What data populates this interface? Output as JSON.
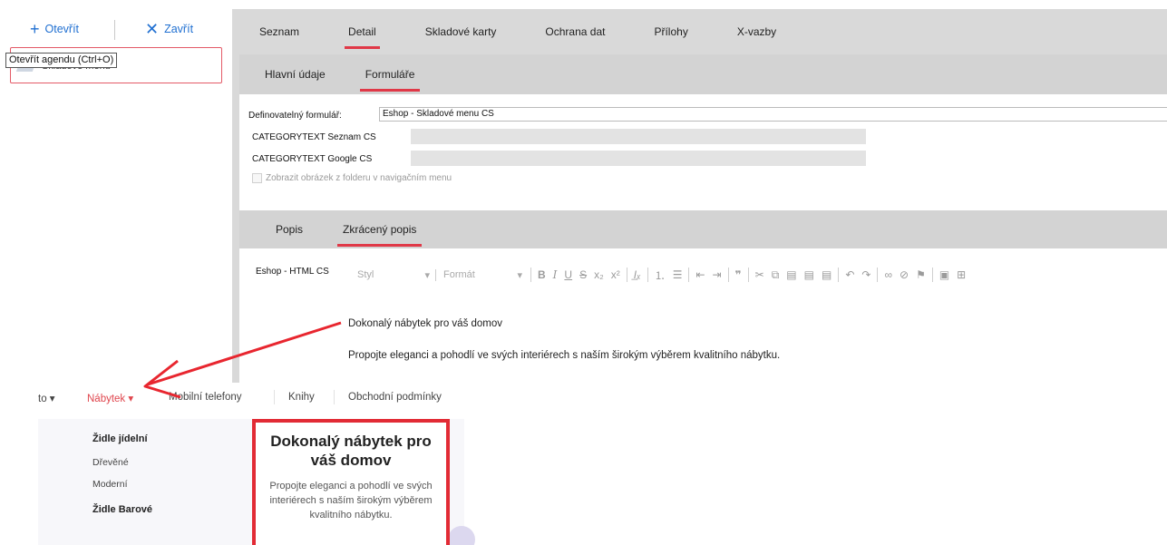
{
  "toolbar": {
    "open_label": "Otevřít",
    "close_label": "Zavřít",
    "tooltip": "Otevřít agendu (Ctrl+O)",
    "agenda_item": "Skladové menu"
  },
  "main_tabs": [
    "Seznam",
    "Detail",
    "Skladové karty",
    "Ochrana dat",
    "Přílohy",
    "X-vazby"
  ],
  "main_tab_active": "Detail",
  "sub_tabs": [
    "Hlavní údaje",
    "Formuláře"
  ],
  "sub_tab_active": "Formuláře",
  "form": {
    "formular_label": "Definovatelný formulář:",
    "formular_value": "Eshop - Skladové menu CS",
    "seznam_label": "CATEGORYTEXT Seznam CS",
    "google_label": "CATEGORYTEXT Google CS",
    "checkbox_label": "Zobrazit obrázek z folderu v navigačním menu"
  },
  "popis_tabs": [
    "Popis",
    "Zkrácený popis"
  ],
  "popis_tab_active": "Zkrácený popis",
  "editor": {
    "label": "Eshop - HTML CS",
    "style_placeholder": "Styl",
    "format_placeholder": "Formát",
    "line1": "Dokonalý nábytek pro váš domov",
    "line2": "Propojte eleganci a pohodlí ve svých interiérech s naším širokým výběrem kvalitního nábytku."
  },
  "site": {
    "nav": [
      "to",
      "Nábytek",
      "Mobilní telefony",
      "Knihy",
      "Obchodní podmínky"
    ],
    "dropdown": [
      "Židle jídelní",
      "Dřevěné",
      "Moderní",
      "Židle Barové"
    ],
    "promo_title": "Dokonalý nábytek pro váš domov",
    "promo_text": "Propojte eleganci a pohodlí ve svých interiérech s naším širokým výběrem kvalitního nábytku."
  },
  "colors": {
    "accent_red": "#e03847",
    "link_blue": "#1f6fd1",
    "panel_gray": "#d9d9d9"
  }
}
